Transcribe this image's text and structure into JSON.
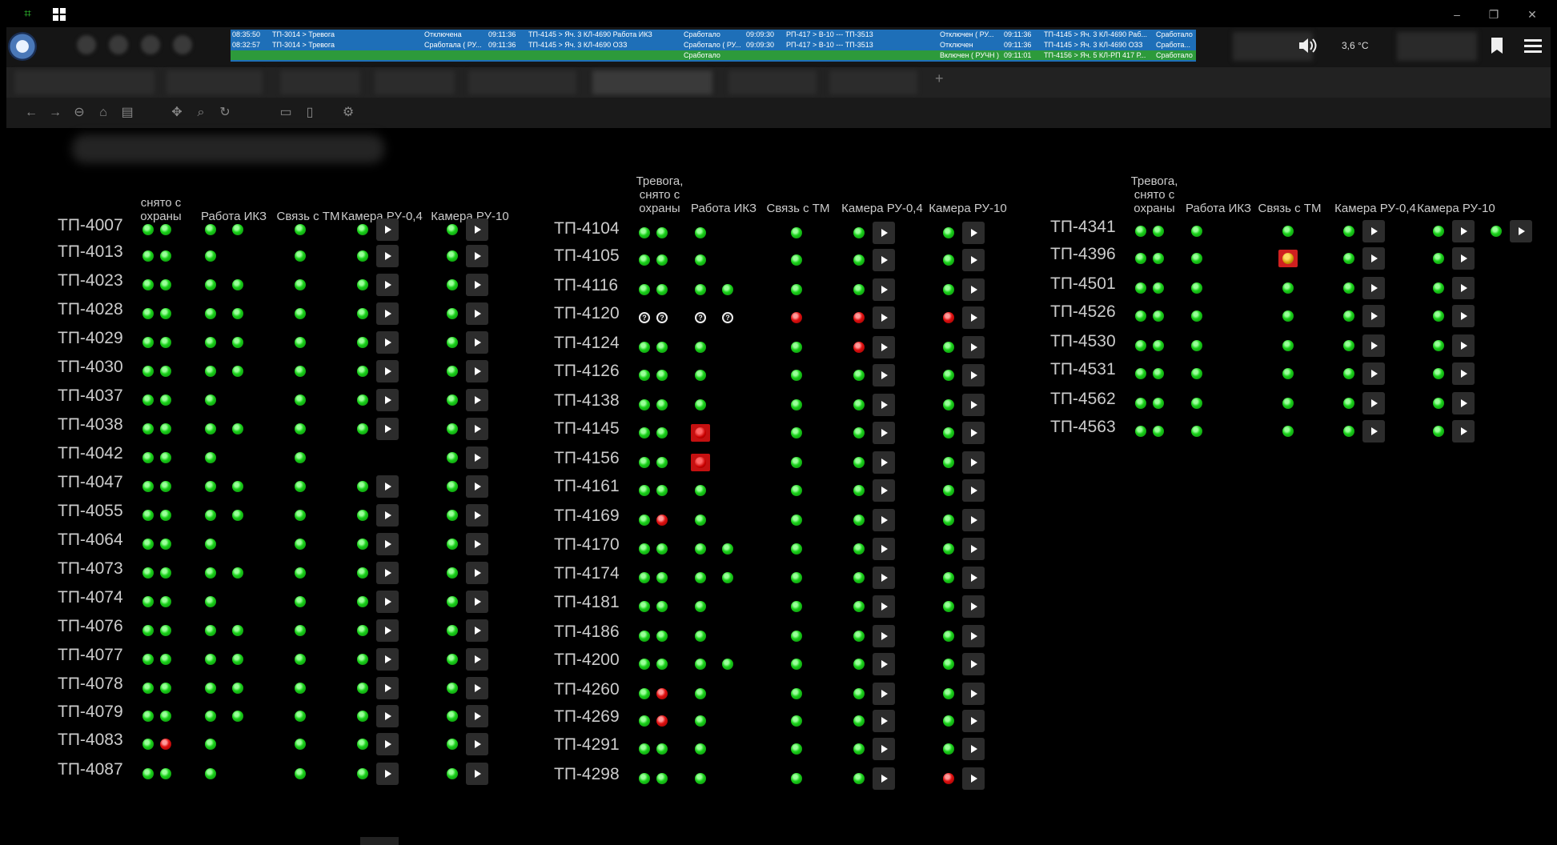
{
  "window": {
    "minimize_glyph": "–",
    "restore_glyph": "❐",
    "close_glyph": "✕"
  },
  "event_log": [
    {
      "time1": "08:35:50",
      "text1": "ТП-3014 > Тревога",
      "state1": "Отключена",
      "time2": "09:11:36",
      "text2": "ТП-4145 > Яч. 3 КЛ-4690 Работа ИКЗ",
      "state2": "Сработало",
      "time3": "09:09:30",
      "text3": "РП-417 > В-10 --- ТП-3513",
      "state3": "Отключен ( РУ...",
      "time4": "09:11:36",
      "text4": "ТП-4145 > Яч. 3 КЛ-4690 Раб...",
      "state4": "Сработало"
    },
    {
      "time1": "08:32:57",
      "text1": "ТП-3014 > Тревога",
      "state1": "Сработала ( РУ...",
      "time2": "09:11:36",
      "text2": "ТП-4145 > Яч. 3 КЛ-4690 ОЗЗ",
      "state2": "Сработало ( РУ...",
      "time3": "09:09:30",
      "text3": "РП-417 > В-10 --- ТП-3513",
      "state3": "Отключен",
      "time4": "09:11:36",
      "text4": "ТП-4145 > Яч. 3 КЛ-4690 ОЗЗ",
      "state4": "Сработа..."
    },
    {
      "time1": "",
      "text1": "",
      "state1": "",
      "time2": "",
      "text2": "",
      "state2": "Сработало",
      "time3": "",
      "text3": "",
      "state3": "Включен ( РУЧН )",
      "time4": "09:11:01",
      "text4": "ТП-4156 > Яч. 5 КЛ-РП 417 Р...",
      "state4": "Сработало"
    }
  ],
  "status": {
    "temperature": "3,6 °C"
  },
  "icons": {
    "app": "app-logo-icon",
    "speaker": "speaker-icon",
    "bookmark": "bookmark-icon",
    "menu": "hamburger-menu-icon",
    "play": "play-icon",
    "back": "back-arrow-icon",
    "forward": "forward-arrow-icon",
    "new_tab": "+"
  },
  "nav": {
    "back": "←",
    "forward": "→",
    "new_tab": "+"
  },
  "colors": {
    "ok": "#19d019",
    "alarm": "#e01010",
    "unknown": "#eeeeee",
    "eventlog_bg": "#1e6fb8"
  },
  "column_headers": {
    "alarm": "Тревога, снято с охраны",
    "alarm_col1_partial": "снято с охраны",
    "ikz": "Работа ИКЗ",
    "tm": "Связь с ТМ",
    "cam04": "Камера РУ-0,4",
    "cam10": "Камера РУ-10"
  },
  "groups": [
    {
      "rows": [
        {
          "name": "ТП-4007",
          "alarm": [
            "g",
            "g"
          ],
          "ikz": [
            "g",
            "g"
          ],
          "tm": "g",
          "cam04": "g",
          "cam10": "g"
        },
        {
          "name": "ТП-4013",
          "alarm": [
            "g",
            "g"
          ],
          "ikz": [
            "g"
          ],
          "tm": "g",
          "cam04": "g",
          "cam10": "g"
        },
        {
          "name": "ТП-4023",
          "alarm": [
            "g",
            "g"
          ],
          "ikz": [
            "g",
            "g"
          ],
          "tm": "g",
          "cam04": "g",
          "cam10": "g"
        },
        {
          "name": "ТП-4028",
          "alarm": [
            "g",
            "g"
          ],
          "ikz": [
            "g",
            "g"
          ],
          "tm": "g",
          "cam04": "g",
          "cam10": "g"
        },
        {
          "name": "ТП-4029",
          "alarm": [
            "g",
            "g"
          ],
          "ikz": [
            "g",
            "g"
          ],
          "tm": "g",
          "cam04": "g",
          "cam10": "g"
        },
        {
          "name": "ТП-4030",
          "alarm": [
            "g",
            "g"
          ],
          "ikz": [
            "g",
            "g"
          ],
          "tm": "g",
          "cam04": "g",
          "cam10": "g"
        },
        {
          "name": "ТП-4037",
          "alarm": [
            "g",
            "g"
          ],
          "ikz": [
            "g"
          ],
          "tm": "g",
          "cam04": "g",
          "cam10": "g"
        },
        {
          "name": "ТП-4038",
          "alarm": [
            "g",
            "g"
          ],
          "ikz": [
            "g",
            "g"
          ],
          "tm": "g",
          "cam04": "g",
          "cam10": "g"
        },
        {
          "name": "ТП-4042",
          "alarm": [
            "g",
            "g"
          ],
          "ikz": [
            "g"
          ],
          "tm": "g",
          "cam04": null,
          "cam10": "g"
        },
        {
          "name": "ТП-4047",
          "alarm": [
            "g",
            "g"
          ],
          "ikz": [
            "g",
            "g"
          ],
          "tm": "g",
          "cam04": "g",
          "cam10": "g"
        },
        {
          "name": "ТП-4055",
          "alarm": [
            "g",
            "g"
          ],
          "ikz": [
            "g",
            "g"
          ],
          "tm": "g",
          "cam04": "g",
          "cam10": "g"
        },
        {
          "name": "ТП-4064",
          "alarm": [
            "g",
            "g"
          ],
          "ikz": [
            "g"
          ],
          "tm": "g",
          "cam04": "g",
          "cam10": "g"
        },
        {
          "name": "ТП-4073",
          "alarm": [
            "g",
            "g"
          ],
          "ikz": [
            "g",
            "g"
          ],
          "tm": "g",
          "cam04": "g",
          "cam10": "g"
        },
        {
          "name": "ТП-4074",
          "alarm": [
            "g",
            "g"
          ],
          "ikz": [
            "g"
          ],
          "tm": "g",
          "cam04": "g",
          "cam10": "g"
        },
        {
          "name": "ТП-4076",
          "alarm": [
            "g",
            "g"
          ],
          "ikz": [
            "g",
            "g"
          ],
          "tm": "g",
          "cam04": "g",
          "cam10": "g"
        },
        {
          "name": "ТП-4077",
          "alarm": [
            "g",
            "g"
          ],
          "ikz": [
            "g",
            "g"
          ],
          "tm": "g",
          "cam04": "g",
          "cam10": "g"
        },
        {
          "name": "ТП-4078",
          "alarm": [
            "g",
            "g"
          ],
          "ikz": [
            "g",
            "g"
          ],
          "tm": "g",
          "cam04": "g",
          "cam10": "g"
        },
        {
          "name": "ТП-4079",
          "alarm": [
            "g",
            "g"
          ],
          "ikz": [
            "g",
            "g"
          ],
          "tm": "g",
          "cam04": "g",
          "cam10": "g"
        },
        {
          "name": "ТП-4083",
          "alarm": [
            "g",
            "r"
          ],
          "ikz": [
            "g"
          ],
          "tm": "g",
          "cam04": "g",
          "cam10": "g"
        },
        {
          "name": "ТП-4087",
          "alarm": [
            "g",
            "g"
          ],
          "ikz": [
            "g"
          ],
          "tm": "g",
          "cam04": "g",
          "cam10": "g"
        }
      ]
    },
    {
      "rows": [
        {
          "name": "ТП-4104",
          "alarm": [
            "g",
            "g"
          ],
          "ikz": [
            "g"
          ],
          "tm": "g",
          "cam04": "g",
          "cam10": "g"
        },
        {
          "name": "ТП-4105",
          "alarm": [
            "g",
            "g"
          ],
          "ikz": [
            "g"
          ],
          "tm": "g",
          "cam04": "g",
          "cam10": "g"
        },
        {
          "name": "ТП-4116",
          "alarm": [
            "g",
            "g"
          ],
          "ikz": [
            "g",
            "g"
          ],
          "tm": "g",
          "cam04": "g",
          "cam10": "g"
        },
        {
          "name": "ТП-4120",
          "alarm": [
            "q",
            "q"
          ],
          "ikz": [
            "q",
            "q"
          ],
          "tm": "r",
          "cam04": "r",
          "cam10": "r"
        },
        {
          "name": "ТП-4124",
          "alarm": [
            "g",
            "g"
          ],
          "ikz": [
            "g"
          ],
          "tm": "g",
          "cam04": "r",
          "cam10": "g"
        },
        {
          "name": "ТП-4126",
          "alarm": [
            "g",
            "g"
          ],
          "ikz": [
            "g"
          ],
          "tm": "g",
          "cam04": "g",
          "cam10": "g"
        },
        {
          "name": "ТП-4138",
          "alarm": [
            "g",
            "g"
          ],
          "ikz": [
            "g"
          ],
          "tm": "g",
          "cam04": "g",
          "cam10": "g"
        },
        {
          "name": "ТП-4145",
          "alarm": [
            "g",
            "g"
          ],
          "ikz": [
            "A"
          ],
          "tm": "g",
          "cam04": "g",
          "cam10": "g"
        },
        {
          "name": "ТП-4156",
          "alarm": [
            "g",
            "g"
          ],
          "ikz": [
            "A"
          ],
          "tm": "g",
          "cam04": "g",
          "cam10": "g"
        },
        {
          "name": "ТП-4161",
          "alarm": [
            "g",
            "g"
          ],
          "ikz": [
            "g"
          ],
          "tm": "g",
          "cam04": "g",
          "cam10": "g"
        },
        {
          "name": "ТП-4169",
          "alarm": [
            "g",
            "r"
          ],
          "ikz": [
            "g"
          ],
          "tm": "g",
          "cam04": "g",
          "cam10": "g"
        },
        {
          "name": "ТП-4170",
          "alarm": [
            "g",
            "g"
          ],
          "ikz": [
            "g",
            "g"
          ],
          "tm": "g",
          "cam04": "g",
          "cam10": "g"
        },
        {
          "name": "ТП-4174",
          "alarm": [
            "g",
            "g"
          ],
          "ikz": [
            "g",
            "g"
          ],
          "tm": "g",
          "cam04": "g",
          "cam10": "g"
        },
        {
          "name": "ТП-4181",
          "alarm": [
            "g",
            "g"
          ],
          "ikz": [
            "g"
          ],
          "tm": "g",
          "cam04": "g",
          "cam10": "g"
        },
        {
          "name": "ТП-4186",
          "alarm": [
            "g",
            "g"
          ],
          "ikz": [
            "g"
          ],
          "tm": "g",
          "cam04": "g",
          "cam10": "g"
        },
        {
          "name": "ТП-4200",
          "alarm": [
            "g",
            "g"
          ],
          "ikz": [
            "g",
            "g"
          ],
          "tm": "g",
          "cam04": "g",
          "cam10": "g"
        },
        {
          "name": "ТП-4260",
          "alarm": [
            "g",
            "r"
          ],
          "ikz": [
            "g"
          ],
          "tm": "g",
          "cam04": "g",
          "cam10": "g"
        },
        {
          "name": "ТП-4269",
          "alarm": [
            "g",
            "r"
          ],
          "ikz": [
            "g"
          ],
          "tm": "g",
          "cam04": "g",
          "cam10": "g"
        },
        {
          "name": "ТП-4291",
          "alarm": [
            "g",
            "g"
          ],
          "ikz": [
            "g"
          ],
          "tm": "g",
          "cam04": "g",
          "cam10": "g"
        },
        {
          "name": "ТП-4298",
          "alarm": [
            "g",
            "g"
          ],
          "ikz": [
            "g"
          ],
          "tm": "g",
          "cam04": "g",
          "cam10": "r"
        }
      ]
    },
    {
      "rows": [
        {
          "name": "ТП-4341",
          "alarm": [
            "g",
            "g"
          ],
          "ikz": [
            "g"
          ],
          "tm": "g",
          "cam04": "g",
          "cam10": "g",
          "extra": "g"
        },
        {
          "name": "ТП-4396",
          "alarm": [
            "g",
            "g"
          ],
          "ikz": [
            "g"
          ],
          "tm": "A",
          "cam04": "g",
          "cam10": "g"
        },
        {
          "name": "ТП-4501",
          "alarm": [
            "g",
            "g"
          ],
          "ikz": [
            "g"
          ],
          "tm": "g",
          "cam04": "g",
          "cam10": "g"
        },
        {
          "name": "ТП-4526",
          "alarm": [
            "g",
            "g"
          ],
          "ikz": [
            "g"
          ],
          "tm": "g",
          "cam04": "g",
          "cam10": "g"
        },
        {
          "name": "ТП-4530",
          "alarm": [
            "g",
            "g"
          ],
          "ikz": [
            "g"
          ],
          "tm": "g",
          "cam04": "g",
          "cam10": "g"
        },
        {
          "name": "ТП-4531",
          "alarm": [
            "g",
            "g"
          ],
          "ikz": [
            "g"
          ],
          "tm": "g",
          "cam04": "g",
          "cam10": "g"
        },
        {
          "name": "ТП-4562",
          "alarm": [
            "g",
            "g"
          ],
          "ikz": [
            "g"
          ],
          "tm": "g",
          "cam04": "g",
          "cam10": "g"
        },
        {
          "name": "ТП-4563",
          "alarm": [
            "g",
            "g"
          ],
          "ikz": [
            "g"
          ],
          "tm": "g",
          "cam04": "g",
          "cam10": "g"
        }
      ]
    }
  ]
}
